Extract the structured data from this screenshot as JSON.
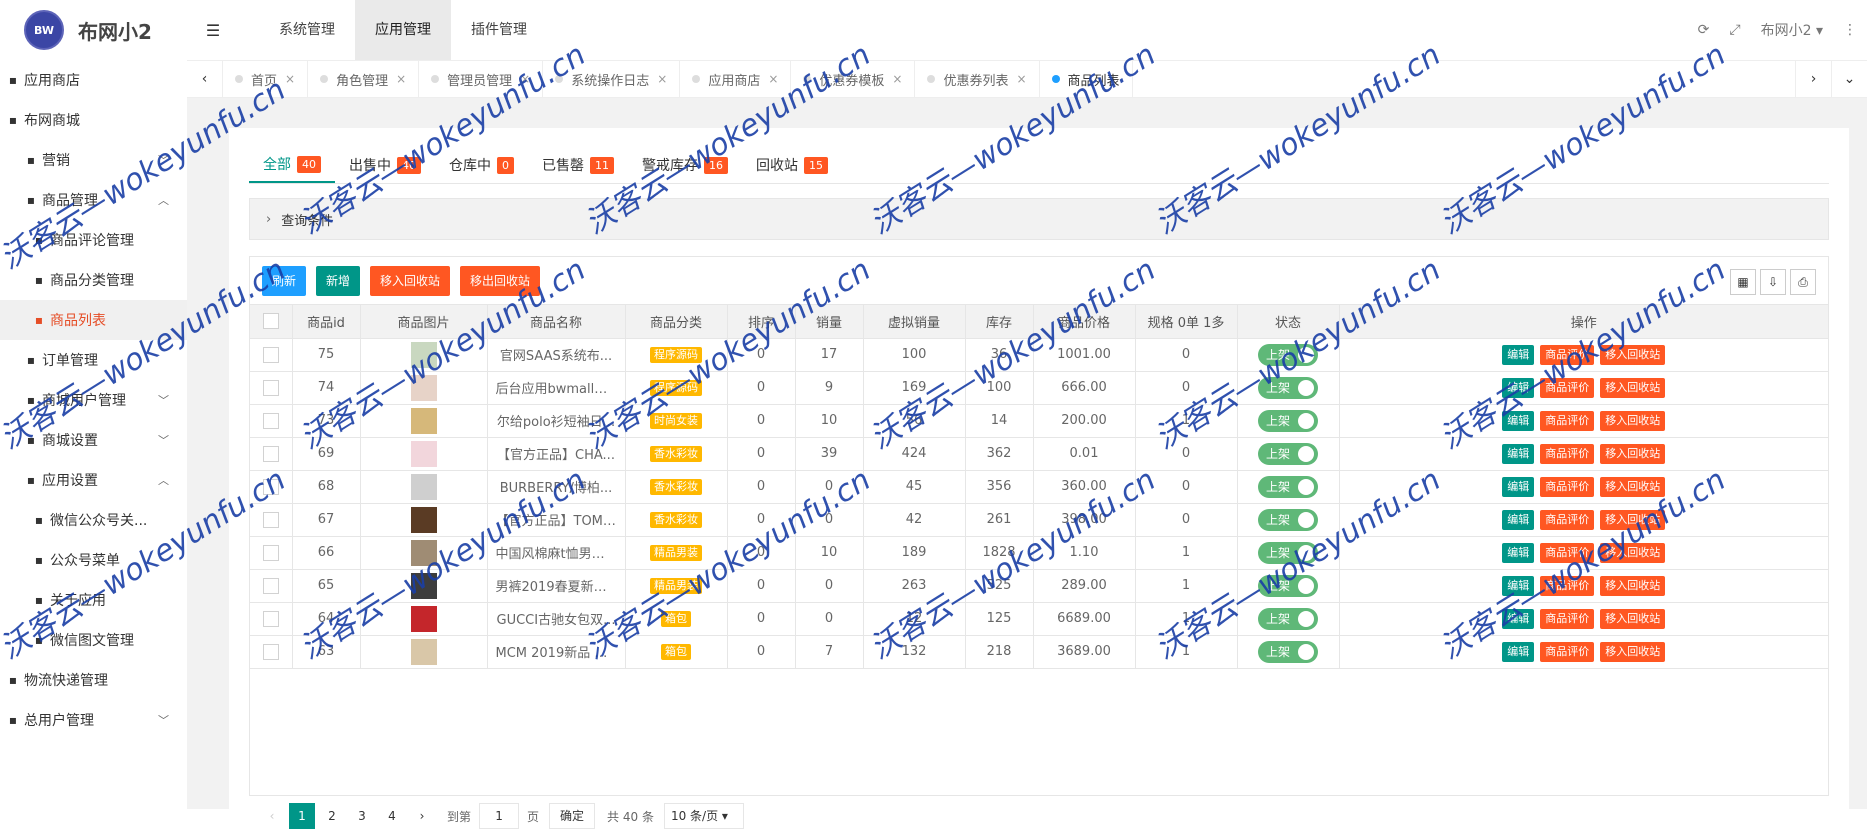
{
  "logo": {
    "badge": "BW",
    "text": "布网小2"
  },
  "sidebar": {
    "items": [
      {
        "label": "应用商店",
        "level": 0
      },
      {
        "label": "布网商城",
        "level": 0
      },
      {
        "label": "营销",
        "level": 1,
        "chev": "﹀"
      },
      {
        "label": "商品管理",
        "level": 1,
        "chev": "︿"
      },
      {
        "label": "商品评论管理",
        "level": 2
      },
      {
        "label": "商品分类管理",
        "level": 2
      },
      {
        "label": "商品列表",
        "level": 2,
        "active": true
      },
      {
        "label": "订单管理",
        "level": 1
      },
      {
        "label": "商城用户管理",
        "level": 1,
        "chev": "﹀"
      },
      {
        "label": "商城设置",
        "level": 1,
        "chev": "﹀"
      },
      {
        "label": "应用设置",
        "level": 1,
        "chev": "︿"
      },
      {
        "label": "微信公众号关...",
        "level": 2
      },
      {
        "label": "公众号菜单",
        "level": 2
      },
      {
        "label": "关于应用",
        "level": 2
      },
      {
        "label": "微信图文管理",
        "level": 2
      },
      {
        "label": "物流快递管理",
        "level": 0
      },
      {
        "label": "总用户管理",
        "level": 0,
        "chev": "﹀"
      }
    ]
  },
  "topnav": {
    "items": [
      "系统管理",
      "应用管理",
      "插件管理"
    ],
    "active_index": 1,
    "user": "布网小2"
  },
  "tabs": [
    {
      "label": "首页"
    },
    {
      "label": "角色管理"
    },
    {
      "label": "管理员管理"
    },
    {
      "label": "系统操作日志"
    },
    {
      "label": "应用商店"
    },
    {
      "label": "优惠券模板"
    },
    {
      "label": "优惠券列表"
    },
    {
      "label": "商品列表",
      "active": true
    }
  ],
  "status_tabs": [
    {
      "label": "全部",
      "count": "40"
    },
    {
      "label": "出售中",
      "count": "40"
    },
    {
      "label": "仓库中",
      "count": "0"
    },
    {
      "label": "已售罄",
      "count": "11"
    },
    {
      "label": "警戒库存",
      "count": "16"
    },
    {
      "label": "回收站",
      "count": "15"
    }
  ],
  "query": {
    "label": "查询条件"
  },
  "toolbar": {
    "refresh": "刷新",
    "add": "新增",
    "to_recycle": "移入回收站",
    "from_recycle": "移出回收站"
  },
  "table": {
    "headers": [
      "",
      "商品id",
      "商品图片",
      "商品名称",
      "商品分类",
      "排序",
      "销量",
      "虚拟销量",
      "库存",
      "商品价格",
      "规格 0单 1多",
      "状态",
      "操作"
    ],
    "status_label": "上架",
    "ops": [
      "编辑",
      "商品评价",
      "移入回收站"
    ],
    "rows": [
      {
        "id": "75",
        "name": "官网SAAS系统布...",
        "cat": "程序源码",
        "sort": "0",
        "sales": "17",
        "vsales": "100",
        "stock": "36",
        "price": "1001.00",
        "spec": "0"
      },
      {
        "id": "74",
        "name": "后台应用bwmall（...",
        "cat": "程序源码",
        "sort": "0",
        "sales": "9",
        "vsales": "169",
        "stock": "100",
        "price": "666.00",
        "spec": "0"
      },
      {
        "id": "73",
        "name": "尔给polo衫短袖日...",
        "cat": "时尚女装",
        "sort": "0",
        "sales": "10",
        "vsales": "56",
        "stock": "14",
        "price": "200.00",
        "spec": "1"
      },
      {
        "id": "69",
        "name": "【官方正品】CHA...",
        "cat": "香水彩妆",
        "sort": "0",
        "sales": "39",
        "vsales": "424",
        "stock": "362",
        "price": "0.01",
        "spec": "0"
      },
      {
        "id": "68",
        "name": "BURBERRY/博柏...",
        "cat": "香水彩妆",
        "sort": "0",
        "sales": "0",
        "vsales": "45",
        "stock": "356",
        "price": "360.00",
        "spec": "0"
      },
      {
        "id": "67",
        "name": "【官方正品】TOM ...",
        "cat": "香水彩妆",
        "sort": "0",
        "sales": "0",
        "vsales": "42",
        "stock": "261",
        "price": "398.00",
        "spec": "0"
      },
      {
        "id": "66",
        "name": "中国风棉麻t恤男装...",
        "cat": "精品男装",
        "sort": "0",
        "sales": "10",
        "vsales": "189",
        "stock": "1828",
        "price": "1.10",
        "spec": "1"
      },
      {
        "id": "65",
        "name": "男裤2019春夏新款...",
        "cat": "精品男装",
        "sort": "0",
        "sales": "0",
        "vsales": "263",
        "stock": "525",
        "price": "289.00",
        "spec": "1"
      },
      {
        "id": "64",
        "name": "GUCCI古驰女包双...",
        "cat": "箱包",
        "sort": "0",
        "sales": "0",
        "vsales": "12",
        "stock": "125",
        "price": "6689.00",
        "spec": "1"
      },
      {
        "id": "63",
        "name": "MCM 2019新品 MI...",
        "cat": "箱包",
        "sort": "0",
        "sales": "7",
        "vsales": "132",
        "stock": "218",
        "price": "3689.00",
        "spec": "1"
      }
    ]
  },
  "pager": {
    "pages": [
      "1",
      "2",
      "3",
      "4"
    ],
    "current": "1",
    "goto_label": "到第",
    "page_unit": "页",
    "input": "1",
    "confirm": "确定",
    "total": "共 40 条",
    "per_page": "10 条/页"
  },
  "watermark": "沃客云—wokeyunfu.cn"
}
